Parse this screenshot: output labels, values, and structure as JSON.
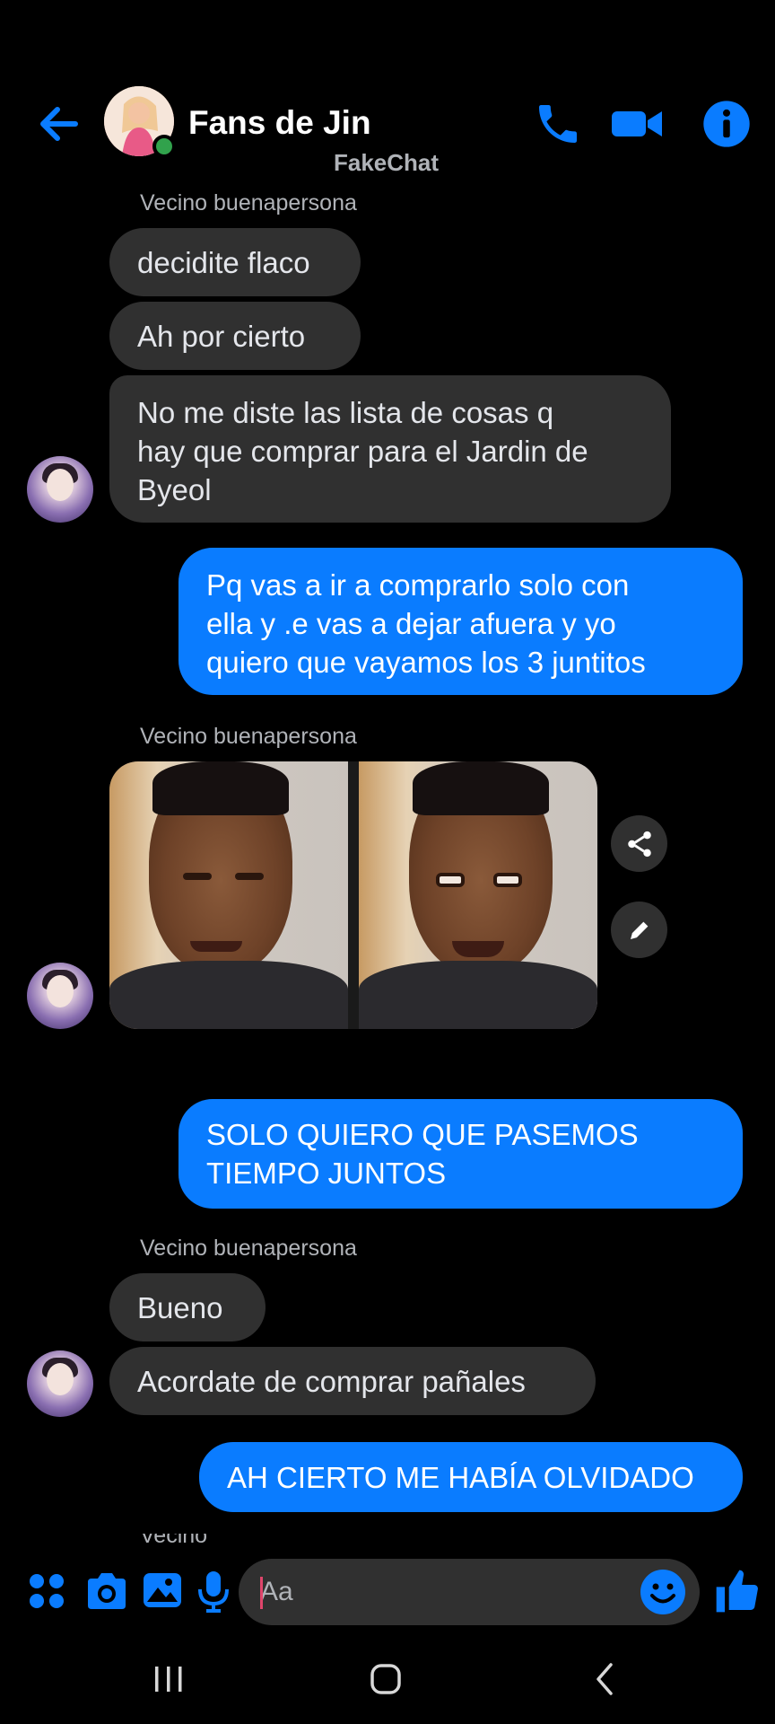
{
  "header": {
    "title": "Fans de Jin",
    "watermark": "FakeChat"
  },
  "messages": {
    "sender_name": "Vecino buenapersona",
    "m1": "decidite flaco",
    "m2": "Ah por cierto",
    "m3_lines": [
      "No me diste las lista de cosas q",
      "hay que comprar para el Jardin de",
      "Byeol"
    ],
    "m4_lines": [
      "Pq vas a ir a comprarlo solo con",
      "ella y .e vas a dejar afuera y yo",
      "quiero que vayamos los 3 juntitos"
    ],
    "m5_lines": [
      "SOLO QUIERO QUE PASEMOS",
      "TIEMPO JUNTOS"
    ],
    "m6": "Bueno",
    "m7": "Acordate de comprar pañales",
    "m8": "AH CIERTO ME HABÍA OLVIDADO"
  },
  "composer": {
    "placeholder": "Aa"
  },
  "colors": {
    "accent": "#0a7cff",
    "incoming_bubble": "#303030",
    "background": "#000000",
    "online": "#31a24c"
  },
  "icons": [
    "back-arrow-icon",
    "phone-icon",
    "video-camera-icon",
    "info-icon",
    "share-icon",
    "pencil-icon",
    "apps-icon",
    "camera-icon",
    "gallery-icon",
    "microphone-icon",
    "emoji-icon",
    "thumbs-up-icon",
    "recent-apps-icon",
    "home-icon",
    "back-icon"
  ]
}
